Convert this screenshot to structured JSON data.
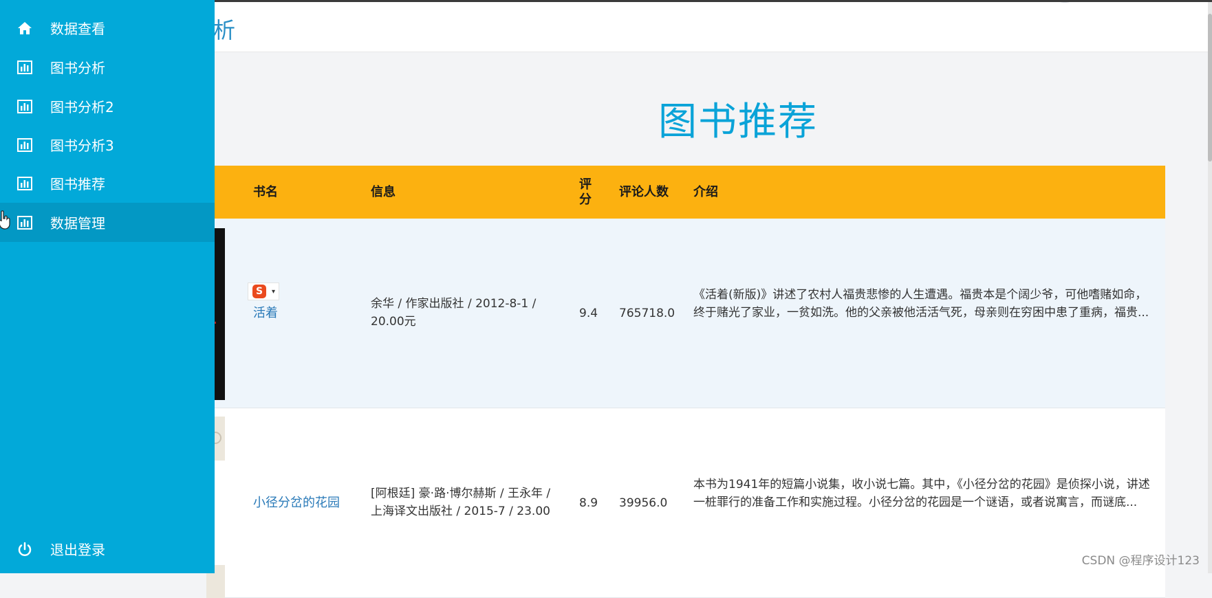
{
  "header": {
    "brand_partial": "析"
  },
  "page": {
    "title": "图书推荐"
  },
  "sidebar": {
    "items": [
      {
        "label": "数据查看",
        "icon": "home-icon"
      },
      {
        "label": "图书分析",
        "icon": "bar-chart-icon"
      },
      {
        "label": "图书分析2",
        "icon": "bar-chart-icon"
      },
      {
        "label": "图书分析3",
        "icon": "bar-chart-icon"
      },
      {
        "label": "图书推荐",
        "icon": "bar-chart-icon"
      },
      {
        "label": "数据管理",
        "icon": "bar-chart-icon",
        "active": true
      }
    ],
    "logout": {
      "label": "退出登录",
      "icon": "power-icon"
    }
  },
  "table": {
    "headers": {
      "name": "书名",
      "info": "信息",
      "rating": "评\n分",
      "reviews": "评论人数",
      "intro": "介绍"
    },
    "rows": [
      {
        "name": "活着",
        "info": "余华 / 作家出版社 / 2012-8-1 / 20.00元",
        "rating": "9.4",
        "reviews": "765718.0",
        "intro": "《活着(新版)》讲述了农村人福贵悲惨的人生遭遇。福贵本是个阔少爷，可他嗜赌如命，终于赌光了家业，一贫如洗。他的父亲被他活活气死，母亲则在穷困中患了重病，福贵..."
      },
      {
        "name": "小径分岔的花园",
        "info": "[阿根廷] 豪·路·博尔赫斯 / 王永年 / 上海译文出版社 / 2015-7 / 23.00",
        "rating": "8.9",
        "reviews": "39956.0",
        "intro": "本书为1941年的短篇小说集，收小说七篇。其中，《小径分岔的花园》是侦探小说，讲述一桩罪行的准备工作和实施过程。小径分岔的花园是一个谜语，或者说寓言，而谜底..."
      }
    ]
  },
  "ime": {
    "letter": "S",
    "arrow": "▾"
  },
  "watermark": "CSDN @程序设计123",
  "colors": {
    "sidebar": "#02a9d9",
    "sidebar_active": "#0398c4",
    "table_header": "#fcb110",
    "title": "#0aa3d8",
    "link": "#2a7ab8"
  }
}
